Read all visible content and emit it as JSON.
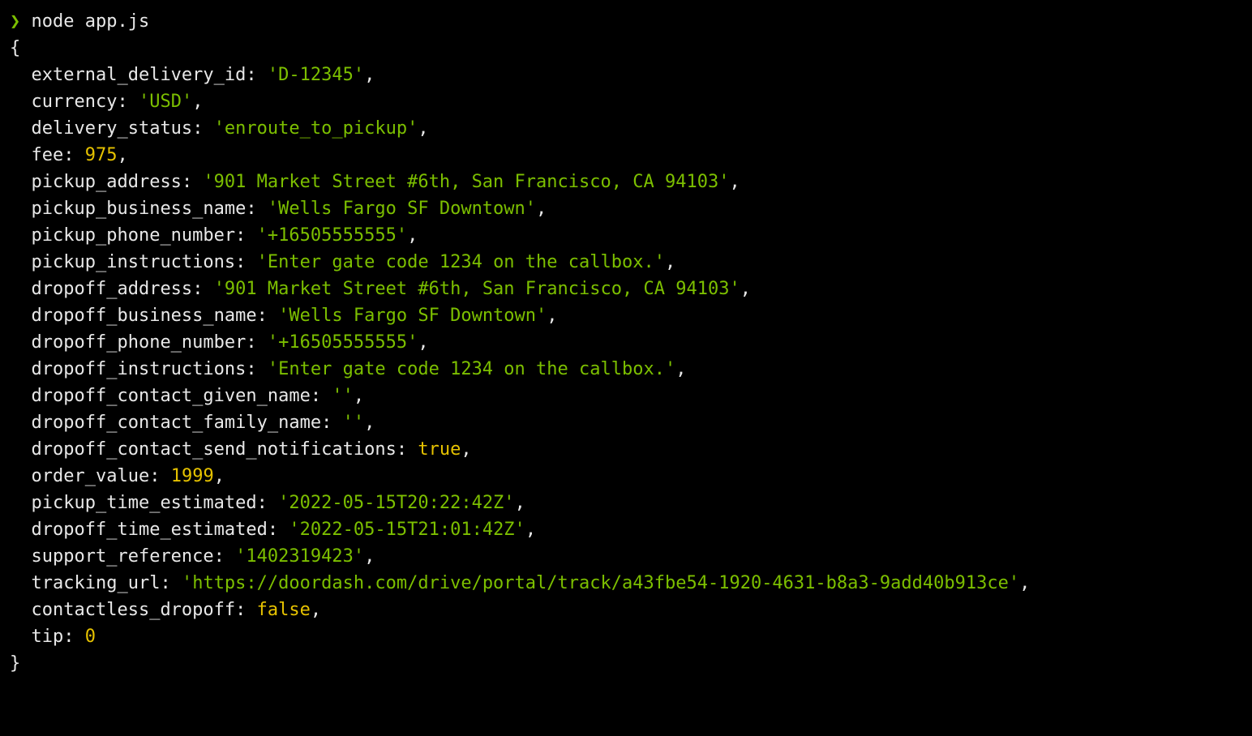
{
  "prompt": {
    "symbol": "❯",
    "command": "node app.js"
  },
  "output": {
    "open_brace": "{",
    "close_brace": "}",
    "entries": [
      {
        "key": "external_delivery_id",
        "type": "string",
        "value": "'D-12345'",
        "trailing_comma": true
      },
      {
        "key": "currency",
        "type": "string",
        "value": "'USD'",
        "trailing_comma": true
      },
      {
        "key": "delivery_status",
        "type": "string",
        "value": "'enroute_to_pickup'",
        "trailing_comma": true
      },
      {
        "key": "fee",
        "type": "number",
        "value": "975",
        "trailing_comma": true
      },
      {
        "key": "pickup_address",
        "type": "string",
        "value": "'901 Market Street #6th, San Francisco, CA 94103'",
        "trailing_comma": true
      },
      {
        "key": "pickup_business_name",
        "type": "string",
        "value": "'Wells Fargo SF Downtown'",
        "trailing_comma": true
      },
      {
        "key": "pickup_phone_number",
        "type": "string",
        "value": "'+16505555555'",
        "trailing_comma": true
      },
      {
        "key": "pickup_instructions",
        "type": "string",
        "value": "'Enter gate code 1234 on the callbox.'",
        "trailing_comma": true
      },
      {
        "key": "dropoff_address",
        "type": "string",
        "value": "'901 Market Street #6th, San Francisco, CA 94103'",
        "trailing_comma": true
      },
      {
        "key": "dropoff_business_name",
        "type": "string",
        "value": "'Wells Fargo SF Downtown'",
        "trailing_comma": true
      },
      {
        "key": "dropoff_phone_number",
        "type": "string",
        "value": "'+16505555555'",
        "trailing_comma": true
      },
      {
        "key": "dropoff_instructions",
        "type": "string",
        "value": "'Enter gate code 1234 on the callbox.'",
        "trailing_comma": true
      },
      {
        "key": "dropoff_contact_given_name",
        "type": "string",
        "value": "''",
        "trailing_comma": true
      },
      {
        "key": "dropoff_contact_family_name",
        "type": "string",
        "value": "''",
        "trailing_comma": true
      },
      {
        "key": "dropoff_contact_send_notifications",
        "type": "boolean",
        "value": "true",
        "trailing_comma": true
      },
      {
        "key": "order_value",
        "type": "number",
        "value": "1999",
        "trailing_comma": true
      },
      {
        "key": "pickup_time_estimated",
        "type": "string",
        "value": "'2022-05-15T20:22:42Z'",
        "trailing_comma": true
      },
      {
        "key": "dropoff_time_estimated",
        "type": "string",
        "value": "'2022-05-15T21:01:42Z'",
        "trailing_comma": true
      },
      {
        "key": "support_reference",
        "type": "string",
        "value": "'1402319423'",
        "trailing_comma": true
      },
      {
        "key": "tracking_url",
        "type": "string",
        "value": "'https://doordash.com/drive/portal/track/a43fbe54-1920-4631-b8a3-9add40b913ce'",
        "trailing_comma": true
      },
      {
        "key": "contactless_dropoff",
        "type": "boolean",
        "value": "false",
        "trailing_comma": true
      },
      {
        "key": "tip",
        "type": "number",
        "value": "0",
        "trailing_comma": false
      }
    ]
  }
}
